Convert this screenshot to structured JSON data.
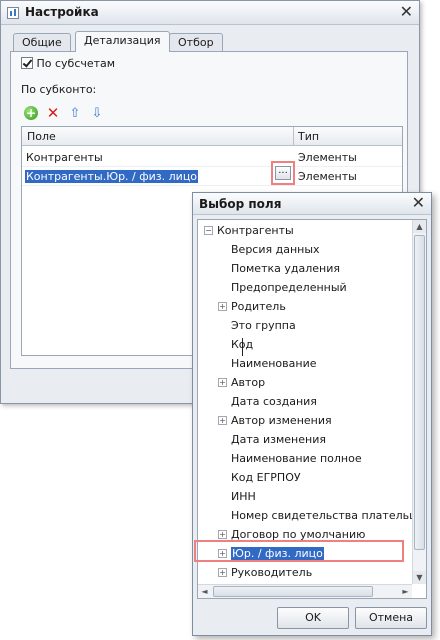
{
  "settings_dialog": {
    "title": "Настройка",
    "close_glyph": "✕",
    "tabs": [
      {
        "label": "Общие",
        "active": false
      },
      {
        "label": "Детализация",
        "active": true
      },
      {
        "label": "Отбор",
        "active": false
      }
    ],
    "by_subaccounts": {
      "label": "По субсчетам",
      "checked": true
    },
    "by_subkonto_label": "По субконто:",
    "toolbar": {
      "add_icon": "+",
      "delete_icon": "✕",
      "up_icon": "⇧",
      "down_icon": "⇩"
    },
    "grid": {
      "columns": [
        "Поле",
        "Тип"
      ],
      "rows": [
        {
          "field": "Контрагенты",
          "type": "Элементы"
        },
        {
          "field": "Контрагенты.Юр. / физ. лицо",
          "type": "Элементы"
        }
      ],
      "ellipsis_label": "..."
    }
  },
  "field_picker": {
    "title": "Выбор поля",
    "close_glyph": "✕",
    "tree": {
      "root": {
        "label": "Контрагенты",
        "expander": "−"
      },
      "items": [
        {
          "label": "Версия данных",
          "expander": ""
        },
        {
          "label": "Пометка удаления",
          "expander": ""
        },
        {
          "label": "Предопределенный",
          "expander": ""
        },
        {
          "label": "Родитель",
          "expander": "+"
        },
        {
          "label": "Это группа",
          "expander": ""
        },
        {
          "label": "Код",
          "expander": ""
        },
        {
          "label": "Наименование",
          "expander": ""
        },
        {
          "label": "Автор",
          "expander": "+"
        },
        {
          "label": "Дата создания",
          "expander": ""
        },
        {
          "label": "Автор изменения",
          "expander": "+"
        },
        {
          "label": "Дата изменения",
          "expander": ""
        },
        {
          "label": "Наименование полное",
          "expander": ""
        },
        {
          "label": "Код ЕГРПОУ",
          "expander": ""
        },
        {
          "label": "ИНН",
          "expander": ""
        },
        {
          "label": "Номер свидетельства плательщика",
          "expander": ""
        },
        {
          "label": "Договор по умолчанию",
          "expander": "+"
        },
        {
          "label": "Юр. / физ. лицо",
          "expander": "+",
          "selected": true
        },
        {
          "label": "Руководитель",
          "expander": "+"
        }
      ]
    },
    "scroll": {
      "up": "▲",
      "down": "▼",
      "left": "◄",
      "right": "►"
    },
    "ok_label": "OK",
    "cancel_label": "Отмена"
  }
}
